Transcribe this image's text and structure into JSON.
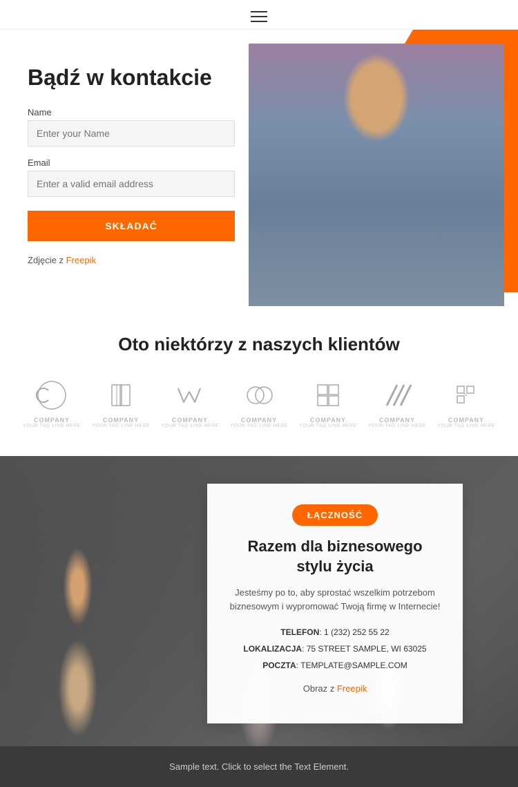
{
  "header": {
    "menu_icon": "hamburger-icon"
  },
  "contact_section": {
    "title": "Bądź w kontakcie",
    "name_label": "Name",
    "name_placeholder": "Enter your Name",
    "email_label": "Email",
    "email_placeholder": "Enter a valid email address",
    "submit_label": "SKŁADAĆ",
    "photo_credit_text": "Zdjęcie z ",
    "photo_credit_link": "Freepik"
  },
  "clients_section": {
    "title": "Oto niektórzy z naszych klientów",
    "logos": [
      {
        "id": "logo1",
        "type": "circle-c",
        "label": "COMPANY",
        "sublabel": "YOUR TAG LINE HERE"
      },
      {
        "id": "logo2",
        "type": "book",
        "label": "COMPANY",
        "sublabel": "YOUR TAG LINE HERE"
      },
      {
        "id": "logo3",
        "type": "checkmark",
        "label": "COMPANY",
        "sublabel": "YOUR TAG LINE HERE"
      },
      {
        "id": "logo4",
        "type": "rings",
        "label": "COMPANY",
        "sublabel": "YOUR TAG LINE HERE"
      },
      {
        "id": "logo5",
        "type": "squares",
        "label": "COMPANY",
        "sublabel": "YOUR TAG LINE HERE"
      },
      {
        "id": "logo6",
        "type": "lines",
        "label": "COMPANY",
        "sublabel": "YOUR TAG LINE HERE"
      },
      {
        "id": "logo7",
        "type": "grid",
        "label": "COMPANY",
        "sublabel": "YOUR TAG LINE HERE"
      }
    ]
  },
  "team_section": {
    "badge_label": "ŁĄCZNOŚĆ",
    "title": "Razem dla biznesowego stylu życia",
    "description": "Jesteśmy po to, aby sprostać wszelkim potrzebom biznesowym i wypromować Twoją firmę w Internecie!",
    "phone_label": "TELEFON",
    "phone_value": "1 (232) 252 55 22",
    "location_label": "LOKALIZACJA",
    "location_value": "75 STREET SAMPLE, WI 63025",
    "email_label": "POCZTA",
    "email_value": "TEMPLATE@SAMPLE.COM",
    "photo_credit_text": "Obraz z ",
    "photo_credit_link": "Freepik"
  },
  "footer": {
    "text": "Sample text. Click to select the Text Element."
  }
}
